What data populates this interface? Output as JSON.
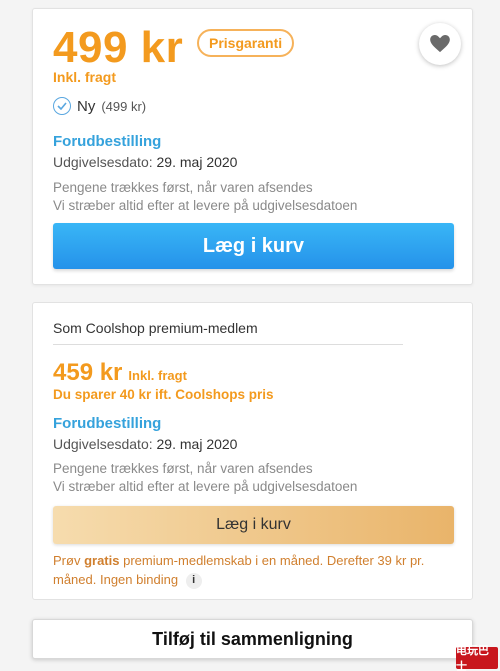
{
  "main_offer": {
    "price": "499 kr",
    "badge": "Prisgaranti",
    "shipping_note": "Inkl. fragt",
    "condition_label": "Ny",
    "condition_price": "(499 kr)",
    "preorder_label": "Forudbestilling",
    "release_label": "Udgivelsesdato:",
    "release_date": "29. maj 2020",
    "note_line1": "Pengene trækkes først, når varen afsendes",
    "note_line2": "Vi stræber altid efter at levere på udgivelsesdatoen",
    "add_to_cart": "Læg i kurv",
    "favorite_icon": "heart-icon"
  },
  "premium_offer": {
    "title": "Som Coolshop premium-medlem",
    "price": "459 kr",
    "shipping_note": "Inkl. fragt",
    "saving": "Du sparer 40 kr ift. Coolshops pris",
    "preorder_label": "Forudbestilling",
    "release_label": "Udgivelsesdato:",
    "release_date": "29. maj 2020",
    "note_line1": "Pengene trækkes først, når varen afsendes",
    "note_line2": "Vi stræber altid efter at levere på udgivelsesdatoen",
    "add_to_cart": "Læg i kurv",
    "trial_prefix": "Prøv",
    "trial_bold": "gratis",
    "trial_rest": "premium-medlemskab i en måned. Derefter 39 kr pr. måned. Ingen binding",
    "info_glyph": "i"
  },
  "compare_button": "Tilføj til sammenligning",
  "watermark": "电玩巴士",
  "colors": {
    "price_orange": "#f39a1e",
    "link_blue": "#35a2dc",
    "cart_blue": "#2592ea",
    "premium_gold": "#e9b46a"
  }
}
